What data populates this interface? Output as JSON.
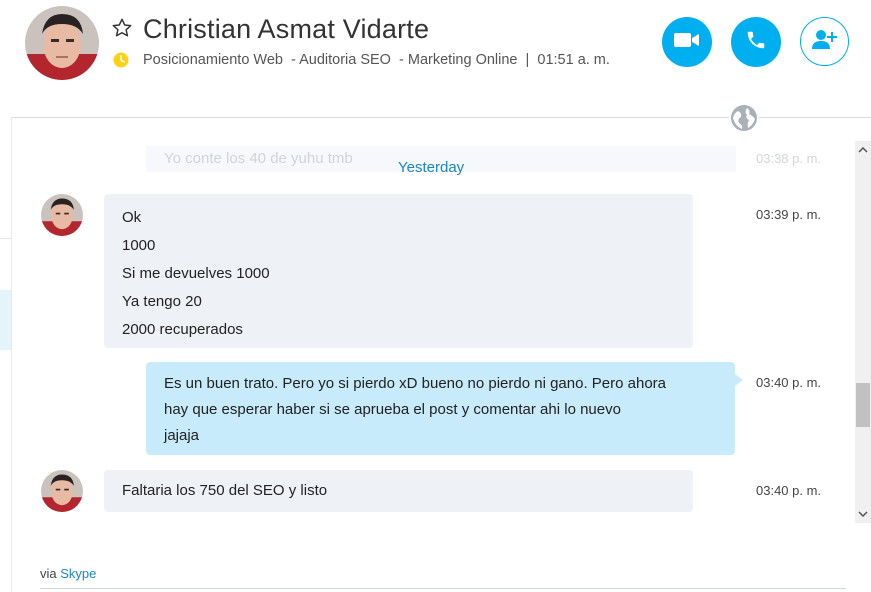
{
  "header": {
    "contact_name": "Christian Asmat Vidarte",
    "mood_message": "Posicionamiento Web  - Auditoria SEO  - Marketing Online  |  ",
    "local_time": "01:51 a. m."
  },
  "icons": {
    "favorite": "star-outline-icon",
    "mood": "clock-icon",
    "video": "video-camera-icon",
    "call": "phone-icon",
    "add": "add-person-icon",
    "globe": "globe-icon"
  },
  "colors": {
    "accent": "#00aff0",
    "incoming_bubble": "#eef1f5",
    "outgoing_bubble": "#c7ebfa",
    "link": "#1a85c8"
  },
  "conversation": {
    "faded_message": "Yo conte los 40 de yuhu tmb",
    "faded_time": "03:38 p. m.",
    "date_separator": "Yesterday",
    "messages": [
      {
        "direction": "incoming",
        "lines": [
          "Ok",
          "1000",
          "Si me devuelves 1000",
          "Ya tengo 20",
          "2000 recuperados"
        ],
        "time": "03:39 p. m."
      },
      {
        "direction": "outgoing",
        "lines": [
          "Es un buen trato. Pero yo si pierdo xD bueno no pierdo ni gano. Pero ahora",
          "hay que esperar haber si se aprueba el post y comentar ahi lo nuevo",
          "jajaja"
        ],
        "time": "03:40 p. m."
      },
      {
        "direction": "incoming",
        "lines": [
          "Faltaria los 750 del SEO y listo"
        ],
        "time": "03:40 p. m."
      }
    ]
  },
  "footer": {
    "via_label": "via",
    "via_link": "Skype"
  }
}
